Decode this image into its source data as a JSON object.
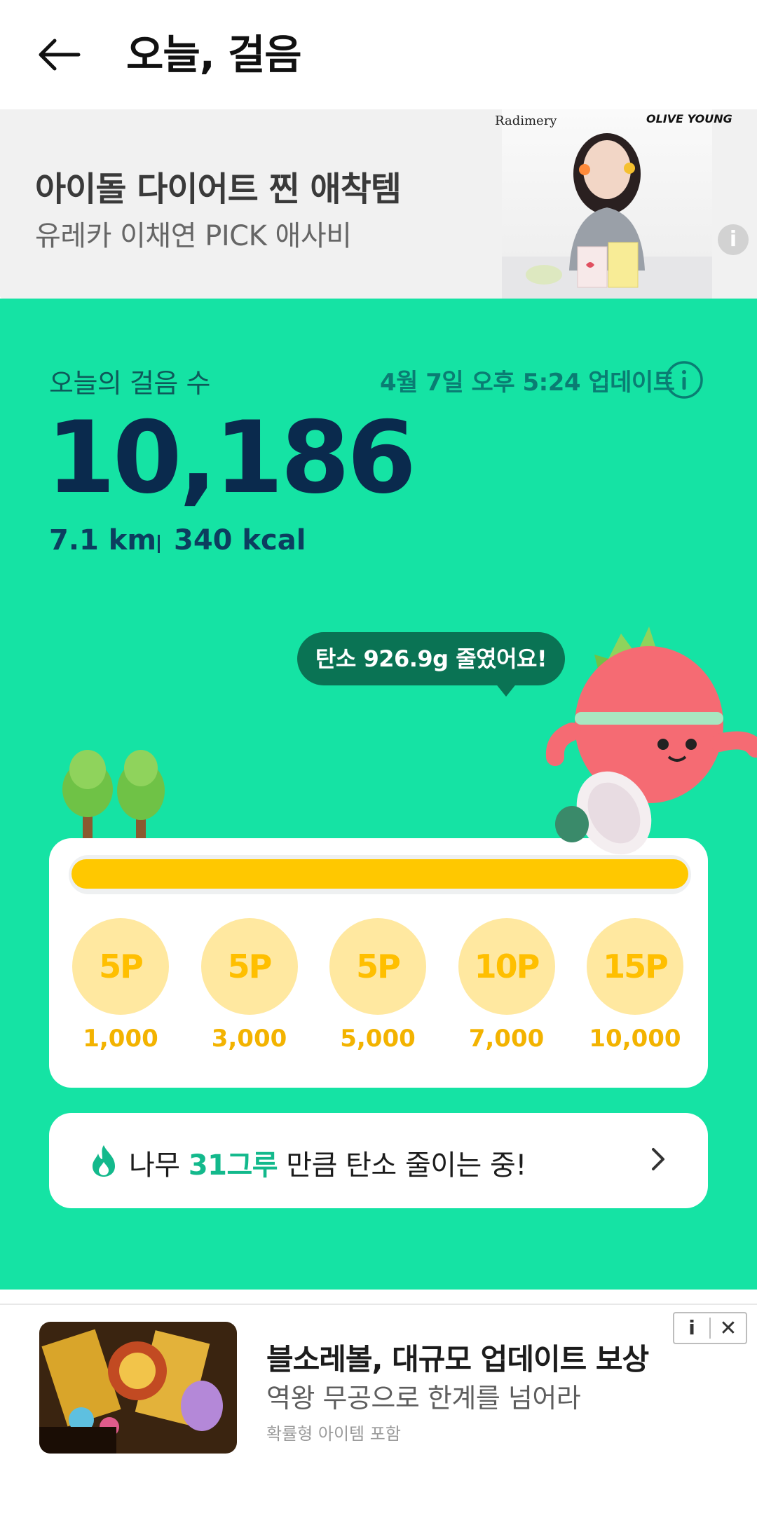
{
  "header": {
    "title": "오늘, 걸음",
    "back_icon": "arrow-left-icon"
  },
  "top_ad": {
    "title": "아이돌 다이어트 찐 애착템",
    "subtitle": "유레카 이채연 PICK 애사비",
    "brand_left": "Radimery",
    "brand_right": "OLIVE YOUNG",
    "info_label": "i"
  },
  "stats": {
    "label": "오늘의 걸음 수",
    "updated": "4월 7일 오후 5:24 업데이트",
    "steps": "10,186",
    "distance": "7.1 km",
    "calories": "340 kcal"
  },
  "bubble": {
    "text": "탄소 926.9g 줄였어요!"
  },
  "progress": {
    "fraction": 1.0,
    "goals": [
      {
        "points": "5P",
        "steps": "1,000"
      },
      {
        "points": "5P",
        "steps": "3,000"
      },
      {
        "points": "5P",
        "steps": "5,000"
      },
      {
        "points": "10P",
        "steps": "7,000"
      },
      {
        "points": "15P",
        "steps": "10,000"
      }
    ]
  },
  "carbon": {
    "prefix": "나무 ",
    "highlight": "31그루",
    "suffix": " 만큼 탄소 줄이는 중!"
  },
  "bottom_ad": {
    "title": "블소레볼, 대규모 업데이트 보상",
    "subtitle": "역왕 무공으로 한계를 넘어라",
    "note": "확률형 아이템 포함",
    "info_label": "i",
    "close_label": "✕"
  },
  "colors": {
    "green_bg": "#15e3a4",
    "bar_fill": "#ffc800",
    "highlight": "#13b98c"
  }
}
